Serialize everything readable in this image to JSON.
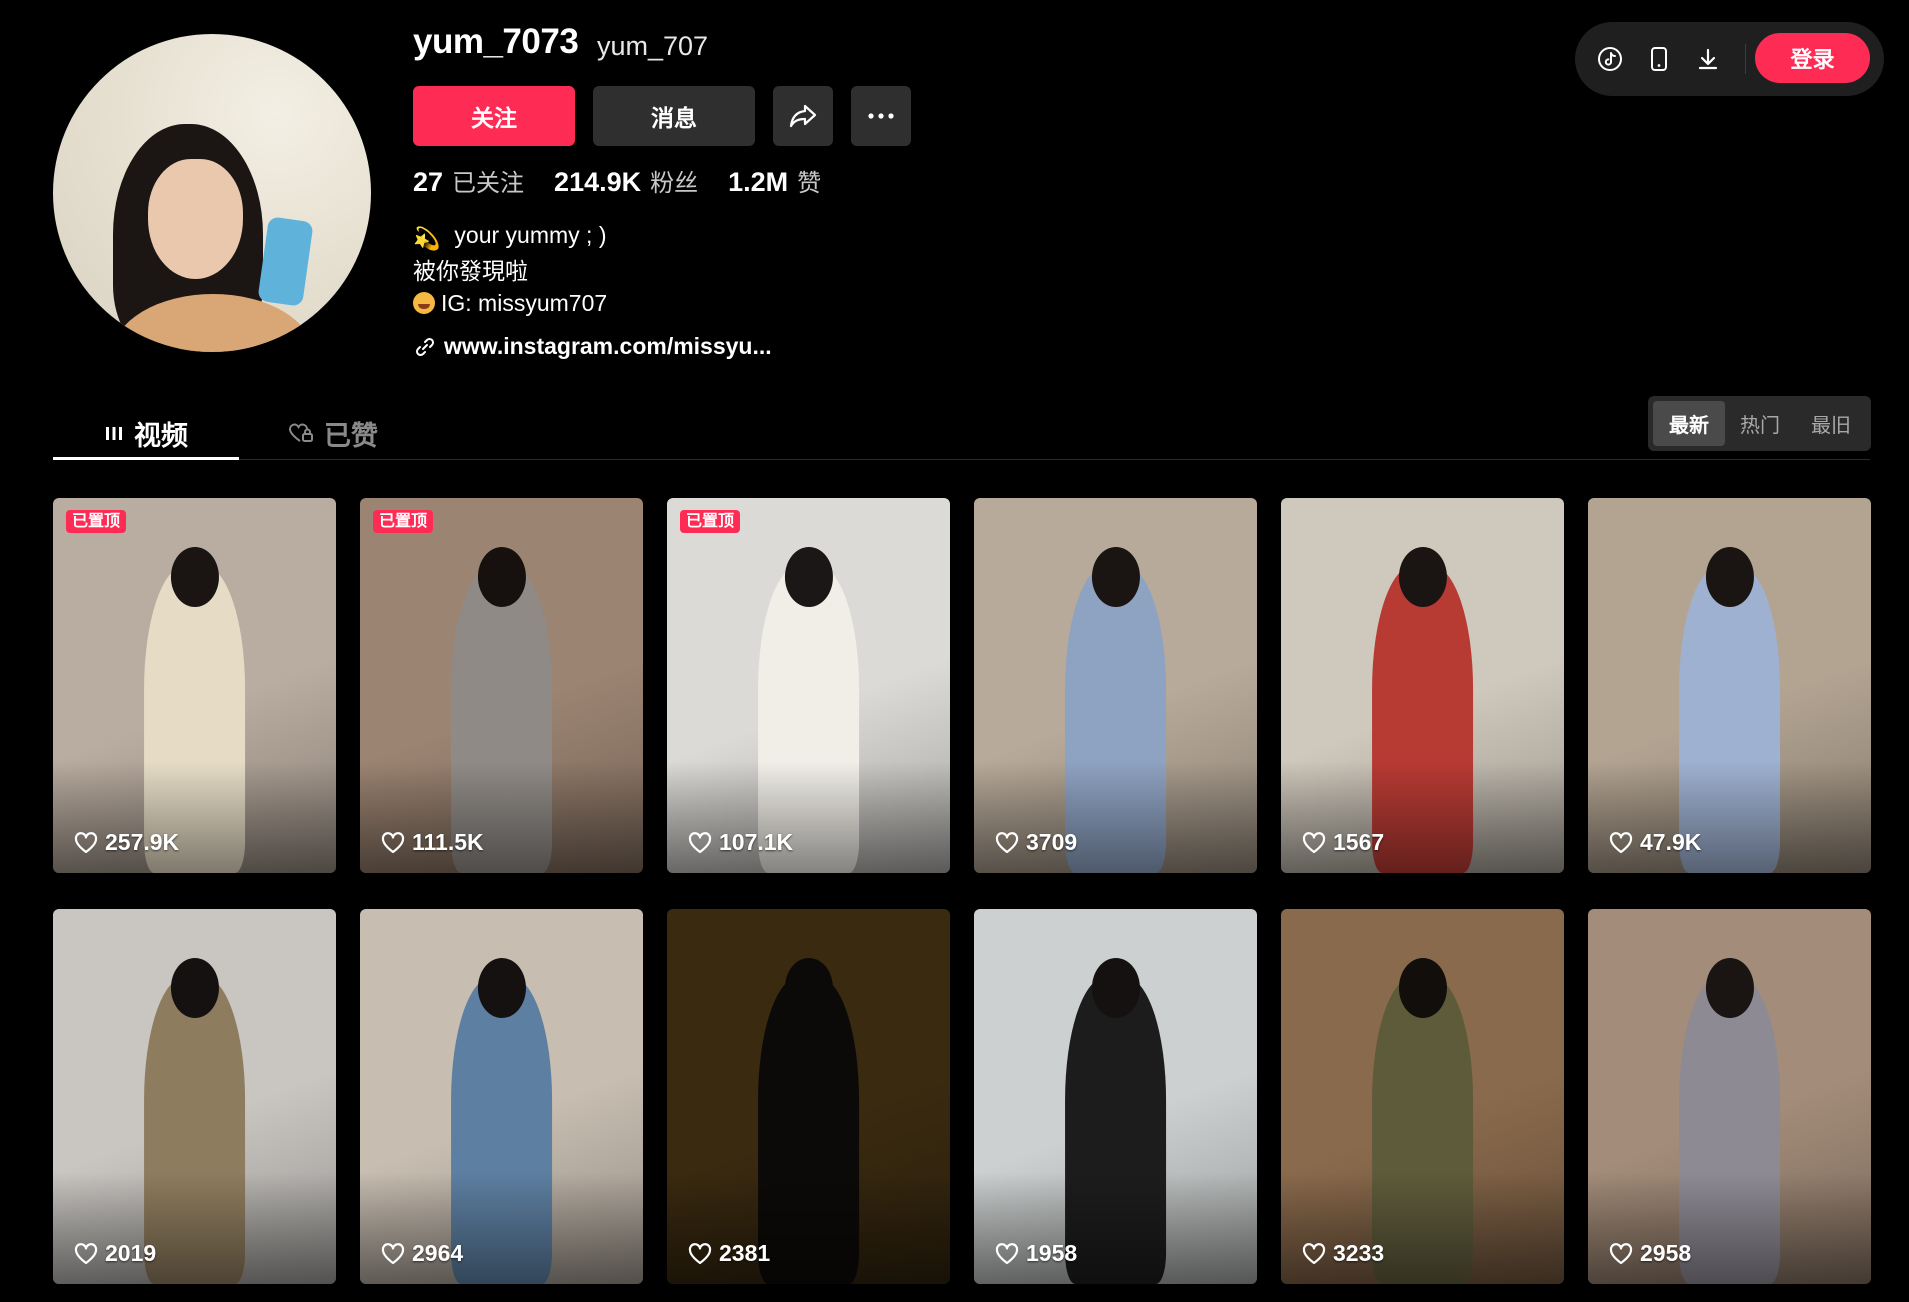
{
  "profile": {
    "username": "yum_7073",
    "handle": "yum_707",
    "follow_label": "关注",
    "message_label": "消息",
    "stats": {
      "following_count": "27",
      "following_label": "已关注",
      "followers_count": "214.9K",
      "followers_label": "粉丝",
      "likes_count": "1.2M",
      "likes_label": "赞"
    },
    "bio": {
      "line1": "your yummy ; )",
      "line2": "被你發現啦",
      "line3": "IG: missyum707"
    },
    "link": "www.instagram.com/missyu..."
  },
  "topbar": {
    "icons": [
      "tiktok-icon",
      "phone-icon",
      "download-icon"
    ],
    "login_label": "登录"
  },
  "tabs": {
    "videos_label": "视频",
    "liked_label": "已赞"
  },
  "sort": {
    "options": [
      "最新",
      "热门",
      "最旧"
    ],
    "selected": "最新"
  },
  "pinned_badge": "已置顶",
  "videos": [
    {
      "likes": "257.9K",
      "pinned": true,
      "bg": "#b9aca0",
      "fig": "#e6dcc6",
      "hair": "#1a1513"
    },
    {
      "likes": "111.5K",
      "pinned": true,
      "bg": "#9c8472",
      "fig": "#8f8a86",
      "hair": "#16110f"
    },
    {
      "likes": "107.1K",
      "pinned": true,
      "bg": "#dcdad6",
      "fig": "#f1eee8",
      "hair": "#1a1716"
    },
    {
      "likes": "3709",
      "pinned": false,
      "bg": "#b8aa9a",
      "fig": "#8ea2c2",
      "hair": "#1a1513"
    },
    {
      "likes": "1567",
      "pinned": false,
      "bg": "#cfc8bc",
      "fig": "#b73a33",
      "hair": "#1a1513"
    },
    {
      "likes": "47.9K",
      "pinned": false,
      "bg": "#b3a492",
      "fig": "#9eb1d1",
      "hair": "#1a1513"
    },
    {
      "likes": "2019",
      "pinned": false,
      "bg": "#c9c6c2",
      "fig": "#8e7c5e",
      "hair": "#141110"
    },
    {
      "likes": "2964",
      "pinned": false,
      "bg": "#c7bdb1",
      "fig": "#5d7fa1",
      "hair": "#141110"
    },
    {
      "likes": "2381",
      "pinned": false,
      "bg": "#3a2a10",
      "fig": "#0c0a08",
      "hair": "#0c0a08"
    },
    {
      "likes": "1958",
      "pinned": false,
      "bg": "#cdd0d0",
      "fig": "#1c1c1c",
      "hair": "#141110"
    },
    {
      "likes": "3233",
      "pinned": false,
      "bg": "#8a6a4c",
      "fig": "#5e5b3b",
      "hair": "#120e0c"
    },
    {
      "likes": "2958",
      "pinned": false,
      "bg": "#a38c79",
      "fig": "#8d8a93",
      "hair": "#1a1513"
    }
  ]
}
